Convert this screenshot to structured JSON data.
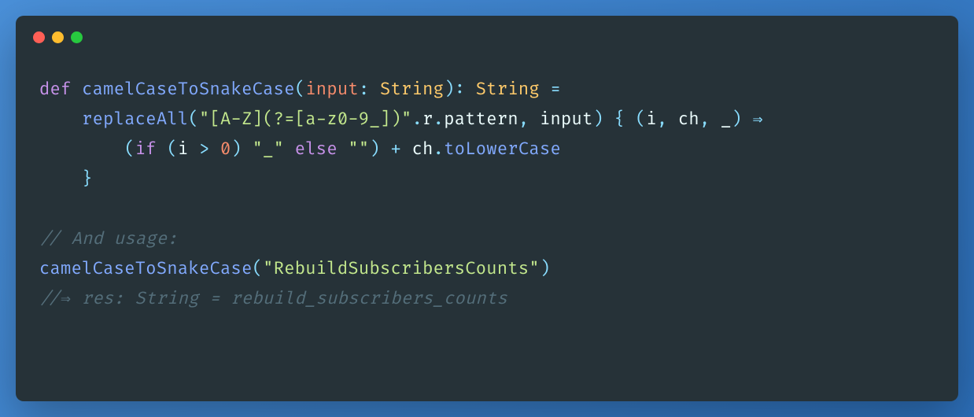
{
  "code": {
    "line1": {
      "t1": "def",
      "t2": " ",
      "t3": "camelCaseToSnakeCase",
      "t4": "(",
      "t5": "input",
      "t6": ":",
      "t7": " ",
      "t8": "String",
      "t9": ")",
      "t10": ":",
      "t11": " ",
      "t12": "String",
      "t13": " ",
      "t14": "="
    },
    "line2": {
      "indent": "    ",
      "t1": "replaceAll",
      "t2": "(",
      "t3": "\"[A-Z](?=[a-z0-9_])\"",
      "t4": ".",
      "t5": "r",
      "t6": ".",
      "t7": "pattern",
      "t8": ",",
      "t9": " ",
      "t10": "input",
      "t11": ")",
      "t12": " ",
      "t13": "{",
      "t14": " ",
      "t15": "(",
      "t16": "i",
      "t17": ",",
      "t18": " ",
      "t19": "ch",
      "t20": ",",
      "t21": " ",
      "t22": "_",
      "t23": ")",
      "t24": " ",
      "t25": "⇒",
      "t26": " "
    },
    "line3": {
      "indent": "        ",
      "t1": "(",
      "t2": "if",
      "t3": " ",
      "t4": "(",
      "t5": "i",
      "t6": " ",
      "t7": ">",
      "t8": " ",
      "t9": "0",
      "t10": ")",
      "t11": " ",
      "t12": "\"_\"",
      "t13": " ",
      "t14": "else",
      "t15": " ",
      "t16": "\"\"",
      "t17": ")",
      "t18": " ",
      "t19": "+",
      "t20": " ",
      "t21": "ch",
      "t22": ".",
      "t23": "toLowerCase"
    },
    "line4": {
      "indent": "    ",
      "t1": "}"
    },
    "line5": "",
    "line6": {
      "t1": "// And usage:"
    },
    "line7": {
      "t1": "camelCaseToSnakeCase",
      "t2": "(",
      "t3": "\"RebuildSubscribersCounts\"",
      "t4": ")"
    },
    "line8": {
      "t1": "//⇒ res: String = rebuild_subscribers_counts"
    }
  }
}
